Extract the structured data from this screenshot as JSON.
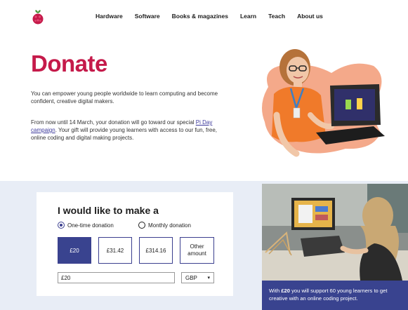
{
  "nav": {
    "logo_icon": "raspberry-pi-logo",
    "items": [
      "Hardware",
      "Software",
      "Books & magazines",
      "Learn",
      "Teach",
      "About us"
    ]
  },
  "hero": {
    "title": "Donate",
    "paragraph1": "You can empower young people worldwide to learn computing and become confident, creative digital makers.",
    "paragraph2_before": "From now until 14 March, your donation will go toward our special ",
    "paragraph2_link": "Pi Day campaign",
    "paragraph2_after": ". Your gift will provide young learners with access to our fun, free, online coding and digital making projects."
  },
  "form": {
    "title": "I would like to make a",
    "radio_one_time": "One-time donation",
    "radio_monthly": "Monthly donation",
    "selected_type": "One-time donation",
    "amounts": [
      "£20",
      "£31.42",
      "£314.16"
    ],
    "other_line1": "Other",
    "other_line2": "amount",
    "selected_amount": "£20",
    "amount_value": "£20",
    "currency": "GBP"
  },
  "caption": {
    "before": "With ",
    "bold": "£20",
    "after": " you will support 60 young learners to get creative with an online coding project."
  },
  "colors": {
    "brand": "#c51a4a",
    "accent": "#39438f",
    "section_bg": "#e8edf6"
  }
}
